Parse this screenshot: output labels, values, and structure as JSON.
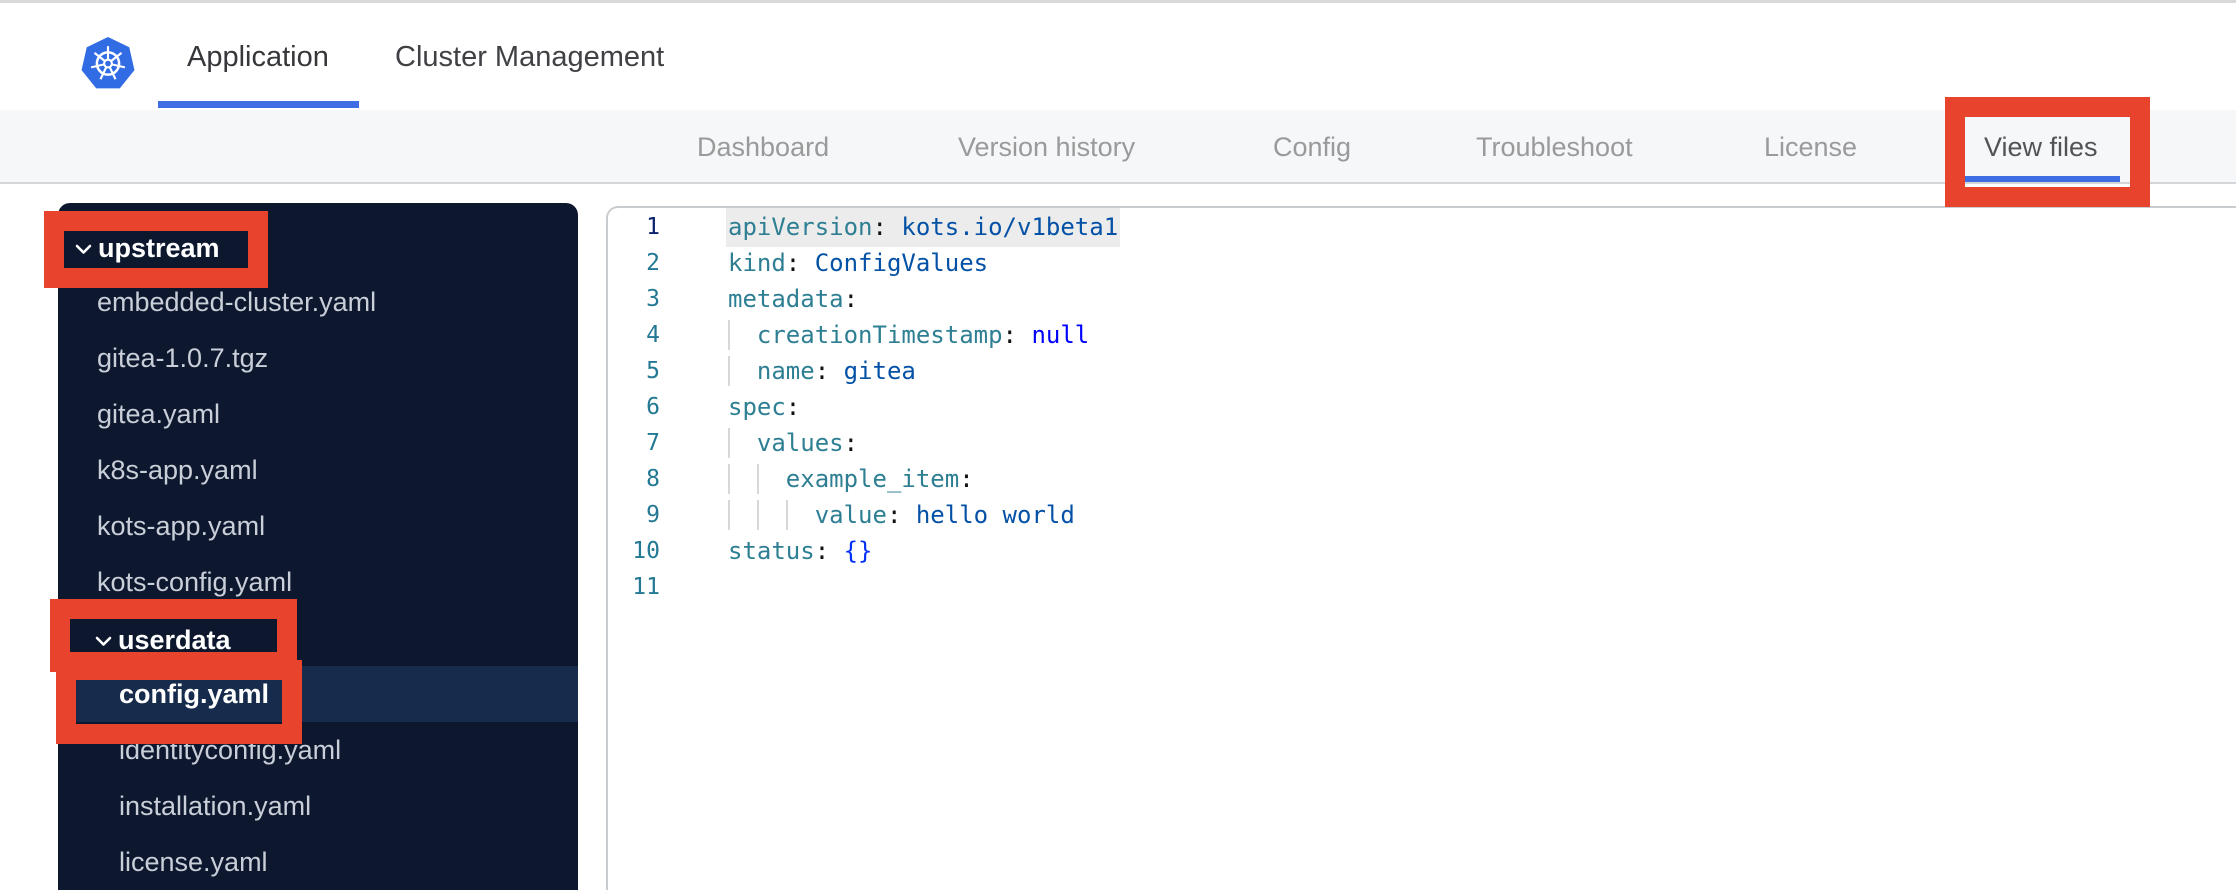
{
  "theme": {
    "accent_blue": "#3e6de4",
    "logo_blue": "#326ce5",
    "annotation_red": "#e8432c",
    "sidebar_bg": "#0d182f",
    "sidebar_selected": "#172c4d",
    "sidebar_file_text": "#c9ced8",
    "code_key": "#2e7f93",
    "code_value": "#0451a5",
    "code_keyword": "#0000ff",
    "code_bracket": "#0431fa",
    "line_number": "#237893",
    "line_number_current": "#0b216f"
  },
  "header": {
    "logo_icon": "kubernetes-helm-wheel",
    "tabs": [
      {
        "label": "Application",
        "active": true
      },
      {
        "label": "Cluster Management",
        "active": false
      }
    ]
  },
  "subnav": {
    "items": [
      {
        "label": "Dashboard",
        "active": false
      },
      {
        "label": "Version history",
        "active": false
      },
      {
        "label": "Config",
        "active": false
      },
      {
        "label": "Troubleshoot",
        "active": false
      },
      {
        "label": "License",
        "active": false
      },
      {
        "label": "View files",
        "active": true
      }
    ]
  },
  "sidebar": {
    "items": [
      {
        "label": "upstream",
        "type": "folder",
        "level": 1,
        "expanded": true,
        "selected": false,
        "annotated": true
      },
      {
        "label": "embedded-cluster.yaml",
        "type": "file",
        "level": 1,
        "selected": false,
        "annotated": false
      },
      {
        "label": "gitea-1.0.7.tgz",
        "type": "file",
        "level": 1,
        "selected": false,
        "annotated": false
      },
      {
        "label": "gitea.yaml",
        "type": "file",
        "level": 1,
        "selected": false,
        "annotated": false
      },
      {
        "label": "k8s-app.yaml",
        "type": "file",
        "level": 1,
        "selected": false,
        "annotated": false
      },
      {
        "label": "kots-app.yaml",
        "type": "file",
        "level": 1,
        "selected": false,
        "annotated": false
      },
      {
        "label": "kots-config.yaml",
        "type": "file",
        "level": 1,
        "selected": false,
        "annotated": false
      },
      {
        "label": "userdata",
        "type": "folder",
        "level": 2,
        "expanded": true,
        "selected": false,
        "annotated": true
      },
      {
        "label": "config.yaml",
        "type": "file",
        "level": 2,
        "selected": true,
        "annotated": true
      },
      {
        "label": "identityconfig.yaml",
        "type": "file",
        "level": 2,
        "selected": false,
        "annotated": false
      },
      {
        "label": "installation.yaml",
        "type": "file",
        "level": 2,
        "selected": false,
        "annotated": false
      },
      {
        "label": "license.yaml",
        "type": "file",
        "level": 2,
        "selected": false,
        "annotated": false
      }
    ]
  },
  "editor": {
    "language": "yaml",
    "lines": [
      {
        "num": 1,
        "current": true,
        "highlighted": true,
        "guides": [],
        "tokens": [
          {
            "t": "apiVersion",
            "c": "key"
          },
          {
            "t": ":",
            "c": "colon"
          },
          {
            "t": " kots.io/v1beta1",
            "c": "value"
          }
        ]
      },
      {
        "num": 2,
        "guides": [],
        "tokens": [
          {
            "t": "kind",
            "c": "key"
          },
          {
            "t": ":",
            "c": "colon"
          },
          {
            "t": " ConfigValues",
            "c": "value"
          }
        ]
      },
      {
        "num": 3,
        "guides": [],
        "tokens": [
          {
            "t": "metadata",
            "c": "key"
          },
          {
            "t": ":",
            "c": "colon"
          }
        ]
      },
      {
        "num": 4,
        "guides": [
          0
        ],
        "tokens": [
          {
            "t": "  ",
            "c": "plain"
          },
          {
            "t": "creationTimestamp",
            "c": "key"
          },
          {
            "t": ":",
            "c": "colon"
          },
          {
            "t": " null",
            "c": "keyword"
          }
        ]
      },
      {
        "num": 5,
        "guides": [
          0
        ],
        "tokens": [
          {
            "t": "  ",
            "c": "plain"
          },
          {
            "t": "name",
            "c": "key"
          },
          {
            "t": ":",
            "c": "colon"
          },
          {
            "t": " gitea",
            "c": "value"
          }
        ]
      },
      {
        "num": 6,
        "guides": [],
        "tokens": [
          {
            "t": "spec",
            "c": "key"
          },
          {
            "t": ":",
            "c": "colon"
          }
        ]
      },
      {
        "num": 7,
        "guides": [
          0
        ],
        "tokens": [
          {
            "t": "  ",
            "c": "plain"
          },
          {
            "t": "values",
            "c": "key"
          },
          {
            "t": ":",
            "c": "colon"
          }
        ]
      },
      {
        "num": 8,
        "guides": [
          0,
          2
        ],
        "tokens": [
          {
            "t": "    ",
            "c": "plain"
          },
          {
            "t": "example_item",
            "c": "key"
          },
          {
            "t": ":",
            "c": "colon"
          }
        ]
      },
      {
        "num": 9,
        "guides": [
          0,
          2,
          4
        ],
        "tokens": [
          {
            "t": "      ",
            "c": "plain"
          },
          {
            "t": "value",
            "c": "key"
          },
          {
            "t": ":",
            "c": "colon"
          },
          {
            "t": " hello world",
            "c": "value"
          }
        ]
      },
      {
        "num": 10,
        "guides": [],
        "tokens": [
          {
            "t": "status",
            "c": "key"
          },
          {
            "t": ":",
            "c": "colon"
          },
          {
            "t": " {}",
            "c": "bracket"
          }
        ]
      },
      {
        "num": 11,
        "guides": [],
        "tokens": []
      }
    ]
  },
  "annotations": {
    "color": "#e8432c",
    "boxes": [
      "view-files-tab",
      "upstream-folder",
      "userdata-folder",
      "config-yaml-file"
    ]
  }
}
